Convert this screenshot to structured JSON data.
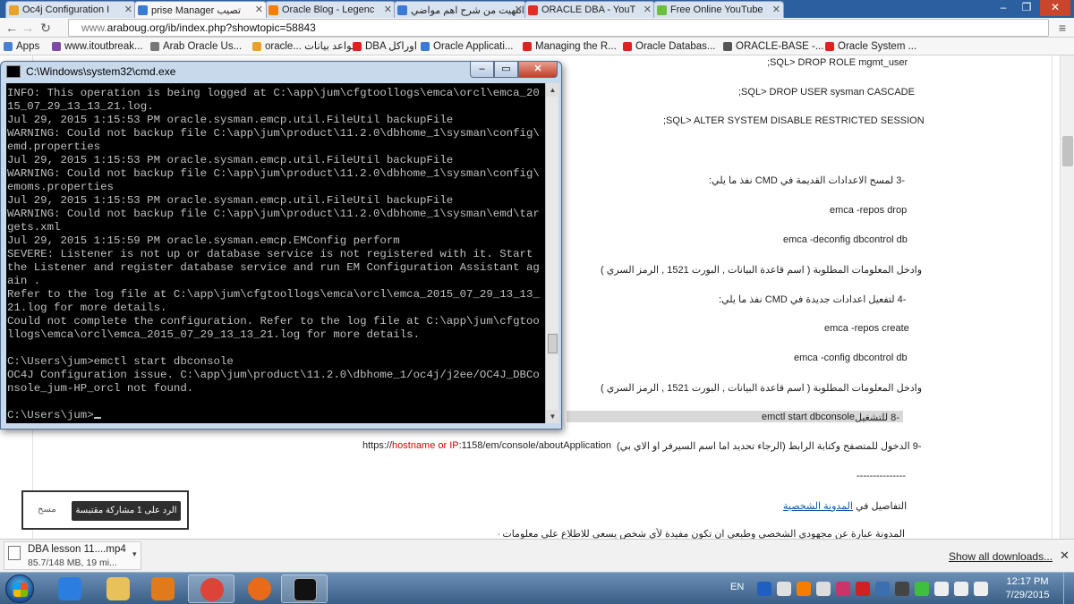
{
  "browser": {
    "tabs": [
      {
        "title": "Oc4j Configuration I",
        "color": "#e8a22c"
      },
      {
        "title": "prise Manager تصيب",
        "color": "#3a7bd5"
      },
      {
        "title": "Oracle Blog - Legenc",
        "color": "#f57d00"
      },
      {
        "title": "انتهيت من شرح اهم مواضي",
        "color": "#3a7bd5"
      },
      {
        "title": "ORACLE DBA - YouT",
        "color": "#e52d27"
      },
      {
        "title": "Free Online YouTube",
        "color": "#6bbf3a"
      }
    ],
    "url_protocol": "www.",
    "url_rest": "araboug.org/ib/index.php?showtopic=58843",
    "bookmarks": [
      {
        "label": "Apps",
        "color": "#4a7fd4"
      },
      {
        "label": "www.itoutbreak...",
        "color": "#7d4ba3"
      },
      {
        "label": "Arab Oracle Us...",
        "color": "#777777"
      },
      {
        "label": "oracle... قواعد بيانات",
        "color": "#e8a22c"
      },
      {
        "label": "DBA اوراكل",
        "color": "#d22"
      },
      {
        "label": "Oracle Applicati...",
        "color": "#3a7bd5"
      },
      {
        "label": "Managing the R...",
        "color": "#d22"
      },
      {
        "label": "Oracle Databas...",
        "color": "#d22"
      },
      {
        "label": "ORACLE-BASE -...",
        "color": "#555555"
      },
      {
        "label": "Oracle System ...",
        "color": "#d22"
      }
    ]
  },
  "post": {
    "l1": ";SQL> DROP ROLE mgmt_user",
    "l2": ";SQL> DROP USER sysman CASCADE",
    "l3": ";SQL> ALTER SYSTEM DISABLE RESTRICTED SESSION",
    "l4": "-3  لمسح الاعدادات القديمة  في CMD نفذ ما يلي:",
    "l5": "emca -repos drop",
    "l6": "emca -deconfig dbcontrol db",
    "l7": "وادخل المعلومات المطلوبة ( اسم قاعدة البيانات , البورت 1521 , الرمز السري )",
    "l8": "-4  لتفعيل اعدادات جديدة  في CMD نفذ ما يلي:",
    "l9": "emca -repos create",
    "l10": "emca -config dbcontrol db",
    "l11": "وادخل المعلومات المطلوبة ( اسم قاعدة البيانات , البورت 1521 , الرمز السري )",
    "l12_cmd": "emctl start dbconsole",
    "l12_text": "-8  للتشغيل",
    "l13_a": "https://",
    "l13_host": "hostname or IP",
    "l13_b": ":1158/em/console/aboutApplication",
    "l13_ar": "-9   الدخول للمتصفح وكتابة الرابط (الرجاء تحديد اما اسم السيرفر او الاي بي)",
    "sep": "---------------",
    "l14_text": "التفاصيل في",
    "l14_link": "المدونة الشخصية",
    "l15": "المدونة عبارة عن مجهودي الشخصي وطبعي ان تكون مفيدة لأي شخص يسعى للاطلاع على معلومات قيمة"
  },
  "reply": {
    "button": "الرد على 1 مشاركة مقتبسة",
    "cancel": "مسح"
  },
  "download": {
    "name": "DBA lesson 11....mp4",
    "progress": "85.7/148 MB, 19 mi...",
    "menu": "▾",
    "show_all": "Show all downloads...",
    "close": "✕"
  },
  "cmd": {
    "title": "C:\\Windows\\system32\\cmd.exe",
    "output": "INFO: This operation is being logged at C:\\app\\jum\\cfgtoollogs\\emca\\orcl\\emca_20\n15_07_29_13_13_21.log.\nJul 29, 2015 1:15:53 PM oracle.sysman.emcp.util.FileUtil backupFile\nWARNING: Could not backup file C:\\app\\jum\\product\\11.2.0\\dbhome_1\\sysman\\config\\\nemd.properties\nJul 29, 2015 1:15:53 PM oracle.sysman.emcp.util.FileUtil backupFile\nWARNING: Could not backup file C:\\app\\jum\\product\\11.2.0\\dbhome_1\\sysman\\config\\\nemoms.properties\nJul 29, 2015 1:15:53 PM oracle.sysman.emcp.util.FileUtil backupFile\nWARNING: Could not backup file C:\\app\\jum\\product\\11.2.0\\dbhome_1\\sysman\\emd\\tar\ngets.xml\nJul 29, 2015 1:15:59 PM oracle.sysman.emcp.EMConfig perform\nSEVERE: Listener is not up or database service is not registered with it. Start\nthe Listener and register database service and run EM Configuration Assistant ag\nain .\nRefer to the log file at C:\\app\\jum\\cfgtoollogs\\emca\\orcl\\emca_2015_07_29_13_13_\n21.log for more details.\nCould not complete the configuration. Refer to the log file at C:\\app\\jum\\cfgtoo\nllogs\\emca\\orcl\\emca_2015_07_29_13_13_21.log for more details.\n\nC:\\Users\\jum>emctl start dbconsole\nOC4J Configuration issue. C:\\app\\jum\\product\\11.2.0\\dbhome_1/oc4j/j2ee/OC4J_DBCo\nnsole_jum-HP_orcl not found.\n\nC:\\Users\\jum>"
  },
  "taskbar": {
    "apps": [
      {
        "name": "internet-explorer",
        "color": "#2b7de0"
      },
      {
        "name": "file-explorer",
        "color": "#e9c15a"
      },
      {
        "name": "media-player",
        "color": "#e07b1b"
      },
      {
        "name": "chrome",
        "color": "#db4437"
      },
      {
        "name": "firefox",
        "color": "#e76b1b"
      },
      {
        "name": "cmd",
        "color": "#111111"
      }
    ],
    "lang": "EN",
    "time": "12:17 PM",
    "date": "7/29/2015",
    "tray": [
      {
        "name": "help-icon",
        "color": "#1f5fbf"
      },
      {
        "name": "network-tool-icon",
        "color": "#e0e0e0"
      },
      {
        "name": "orange-tray-icon",
        "color": "#f57d00"
      },
      {
        "name": "sync-icon",
        "color": "#dddddd"
      },
      {
        "name": "media-tray-icon",
        "color": "#cc3366"
      },
      {
        "name": "tools-tray-icon",
        "color": "#c22"
      },
      {
        "name": "shield-tray-icon",
        "color": "#3a6fb0"
      },
      {
        "name": "display-tray-icon",
        "color": "#444444"
      },
      {
        "name": "signal-icon",
        "color": "#3fbf3f"
      },
      {
        "name": "flag-icon",
        "color": "#eeeeee"
      },
      {
        "name": "volume-icon",
        "color": "#eeeeee"
      },
      {
        "name": "power-icon",
        "color": "#eeeeee"
      }
    ]
  }
}
